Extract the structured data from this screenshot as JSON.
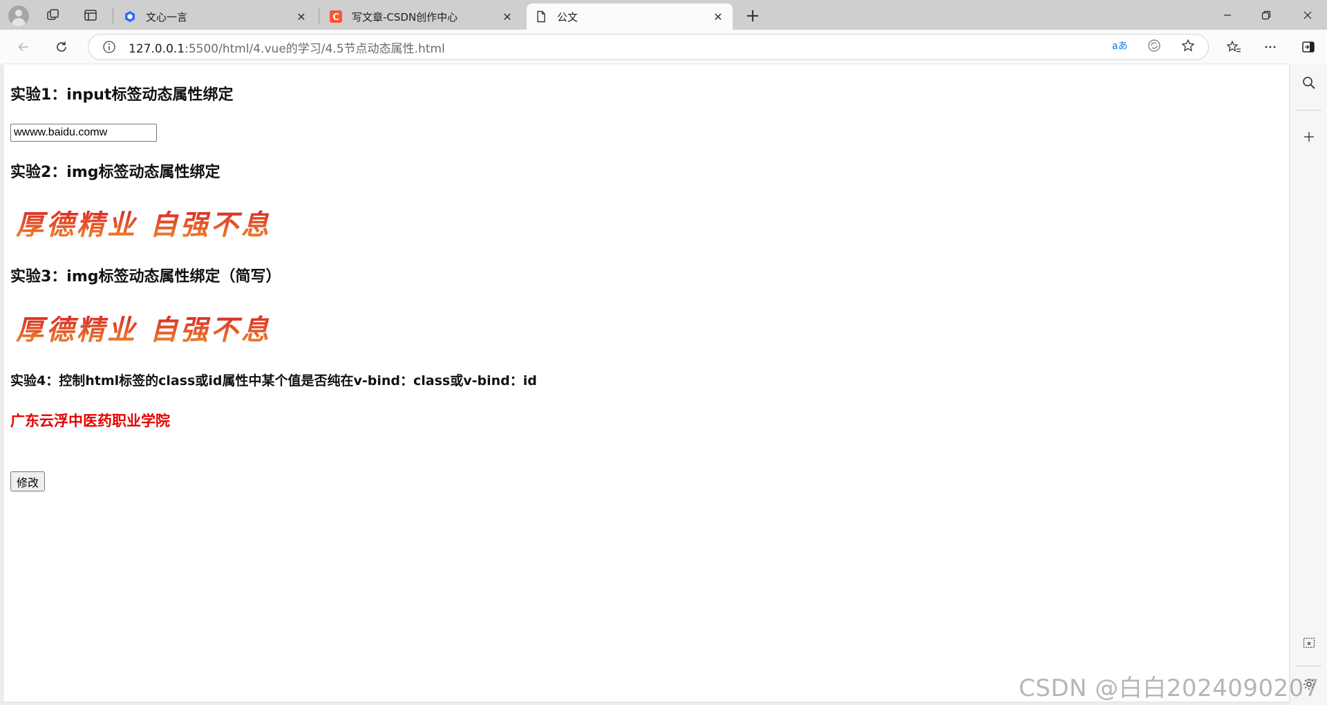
{
  "browser": {
    "tabs": [
      {
        "title": "文心一言",
        "active": false,
        "favicon": "wenxin-icon"
      },
      {
        "title": "写文章-CSDN创作中心",
        "active": false,
        "favicon": "csdn-icon"
      },
      {
        "title": "公文",
        "active": true,
        "favicon": "page-icon"
      }
    ],
    "address": {
      "host": "127.0.0.1",
      "rest": ":5500/html/4.vue的学习/4.5节点动态属性.html"
    },
    "colors": {
      "csdn": "#fc5531",
      "wenxin": "#2a6df4"
    }
  },
  "page": {
    "exp1_title": "实验1：input标签动态属性绑定",
    "input_value": "wwww.baidu.comw",
    "exp2_title": "实验2：img标签动态属性绑定",
    "exp3_title": "实验3：img标签动态属性绑定（简写）",
    "motto_image_text": "厚德精业 自强不息",
    "exp4_title": "实验4：控制html标签的class或id属性中某个值是否纯在v-bind：class或v-bind：id",
    "red_text": "广东云浮中医药职业学院",
    "red_color": "#e60000",
    "modify_button": "修改"
  },
  "watermark": "CSDN @白白2024090207"
}
